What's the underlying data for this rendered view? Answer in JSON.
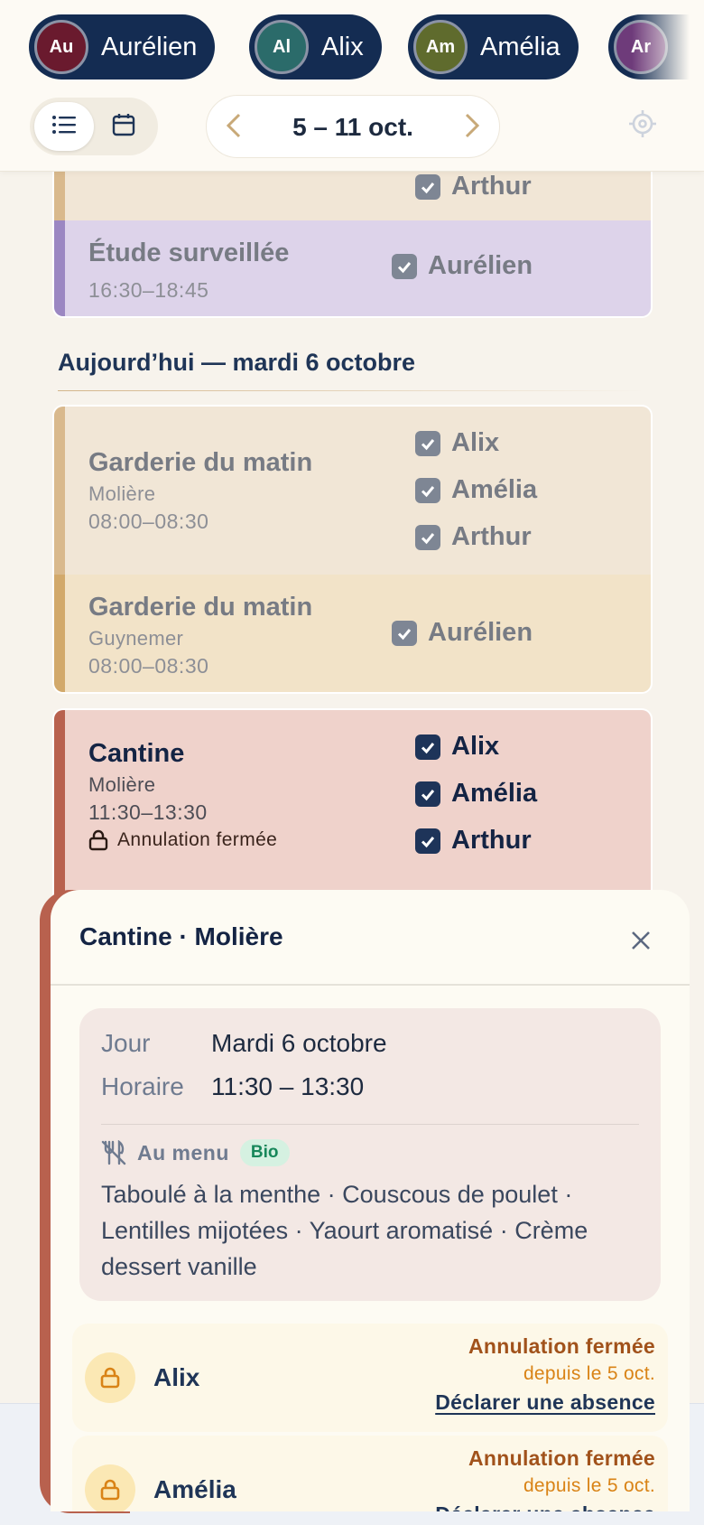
{
  "header": {
    "children": [
      {
        "initials": "Au",
        "name": "Aurélien",
        "color": "#6a1a2e"
      },
      {
        "initials": "Al",
        "name": "Alix",
        "color": "#2b6b6a"
      },
      {
        "initials": "Am",
        "name": "Amélia",
        "color": "#5f6b2d"
      },
      {
        "initials": "Ar",
        "name": "",
        "color": "#6e3b7a"
      }
    ],
    "view_toggle": {
      "active": "list",
      "options": [
        "list-icon",
        "calendar-icon"
      ]
    },
    "week_label": "5 – 11 oct."
  },
  "schedule": {
    "prev_card": {
      "top_row_kid": "Arthur",
      "etude": {
        "title": "Étude surveillée",
        "time": "16:30–18:45",
        "kid": "Aurélien"
      }
    },
    "today_header": "Aujourd’hui — mardi 6 octobre",
    "garderie_moliere": {
      "title": "Garderie du matin",
      "school": "Molière",
      "time": "08:00–08:30",
      "kids": [
        "Alix",
        "Amélia",
        "Arthur"
      ]
    },
    "garderie_guynemer": {
      "title": "Garderie du matin",
      "school": "Guynemer",
      "time": "08:00–08:30",
      "kid": "Aurélien"
    },
    "cantine": {
      "title": "Cantine",
      "school": "Molière",
      "time": "11:30–13:30",
      "lock_text": "Annulation fermée",
      "kids": [
        "Alix",
        "Amélia",
        "Arthur"
      ]
    }
  },
  "sheet": {
    "title": "Cantine · Molière",
    "day_label": "Jour",
    "day_value": "Mardi 6 octobre",
    "hours_label": "Horaire",
    "hours_value": "11:30 – 13:30",
    "menu_label": "Au menu",
    "menu_badge": "Bio",
    "menu_text": "Taboulé à la menthe · Couscous de poulet · Lentilles mijotées · Yaourt aromatisé · Crème dessert vanille",
    "children": [
      {
        "name": "Alix",
        "status": "Annulation fermée",
        "since": "depuis le 5 oct.",
        "action": "Déclarer une absence"
      },
      {
        "name": "Amélia",
        "status": "Annulation fermée",
        "since": "depuis le 5 oct.",
        "action": "Déclarer une absence"
      }
    ]
  },
  "colors": {
    "navy": "#142c52",
    "cantine": "#efd2cb",
    "etude": "#ddd3ea",
    "garderie": "#f1e6d6",
    "lock": "#a1521b"
  }
}
